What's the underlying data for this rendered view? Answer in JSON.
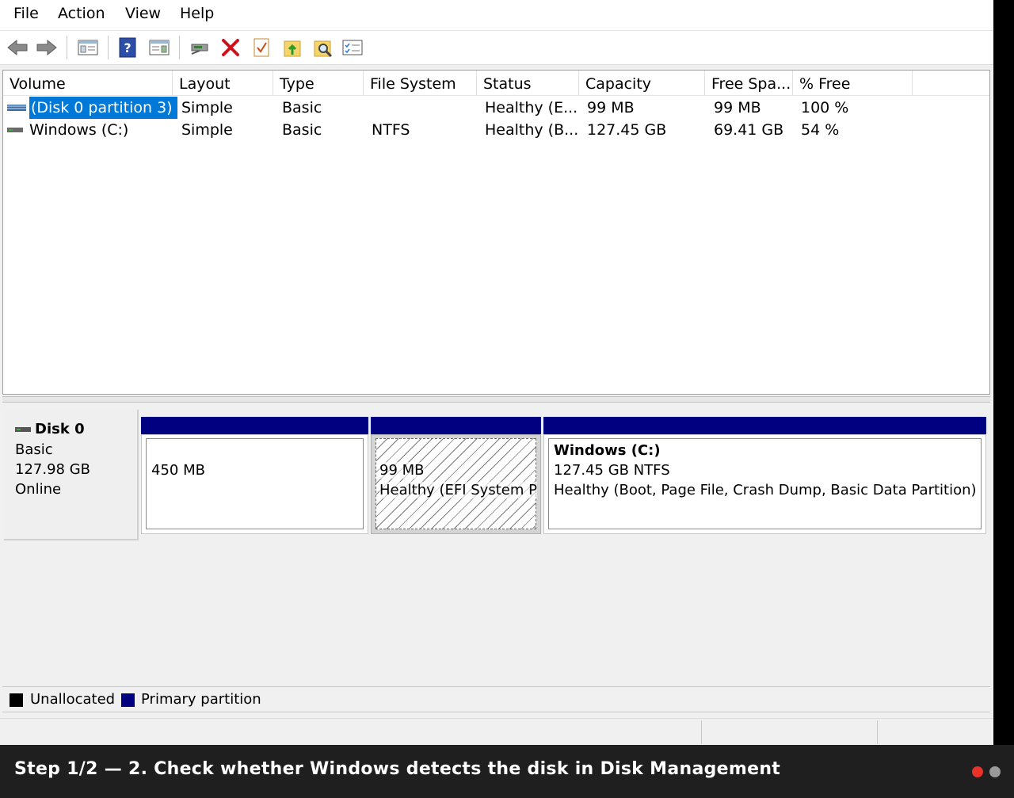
{
  "menu": [
    "File",
    "Action",
    "View",
    "Help"
  ],
  "toolbar": {
    "icons": [
      "back-arrow-icon",
      "forward-arrow-icon",
      "console-tree-icon",
      "help-icon",
      "properties-icon",
      "connect-drive-icon",
      "delete-icon",
      "checklist-icon",
      "folder-up-icon",
      "folder-search-icon",
      "settings-list-icon"
    ]
  },
  "volume_list": {
    "columns": [
      "Volume",
      "Layout",
      "Type",
      "File System",
      "Status",
      "Capacity",
      "Free Spa...",
      "% Free"
    ],
    "rows": [
      {
        "volume": "(Disk 0 partition 3)",
        "layout": "Simple",
        "type": "Basic",
        "fs": "",
        "status": "Healthy (E...",
        "capacity": "99 MB",
        "free": "99 MB",
        "pct": "100 %"
      },
      {
        "volume": "Windows (C:)",
        "layout": "Simple",
        "type": "Basic",
        "fs": "NTFS",
        "status": "Healthy (B...",
        "capacity": "127.45 GB",
        "free": "69.41 GB",
        "pct": "54 %"
      }
    ]
  },
  "disk": {
    "name": "Disk 0",
    "type": "Basic",
    "size": "127.98 GB",
    "state": "Online",
    "partitions": [
      {
        "line1": "450 MB",
        "line2": "",
        "line3": ""
      },
      {
        "line1": "99 MB",
        "line2": "Healthy (EFI System P",
        "line3": ""
      },
      {
        "line1": "Windows  (C:)",
        "line2": "127.45 GB NTFS",
        "line3": "Healthy (Boot, Page File, Crash Dump, Basic Data Partition)"
      }
    ]
  },
  "legend": {
    "unallocated": "Unallocated",
    "primary": "Primary partition",
    "unallocated_color": "#000000",
    "primary_color": "#000080"
  },
  "caption": "Step 1/2 — 2. Check whether Windows detects the disk in Disk Management",
  "colors": {
    "selection": "#0078d7",
    "partition_bar": "#000080",
    "dot_active": "#e8322a",
    "dot_inactive": "#9a9a9a"
  }
}
